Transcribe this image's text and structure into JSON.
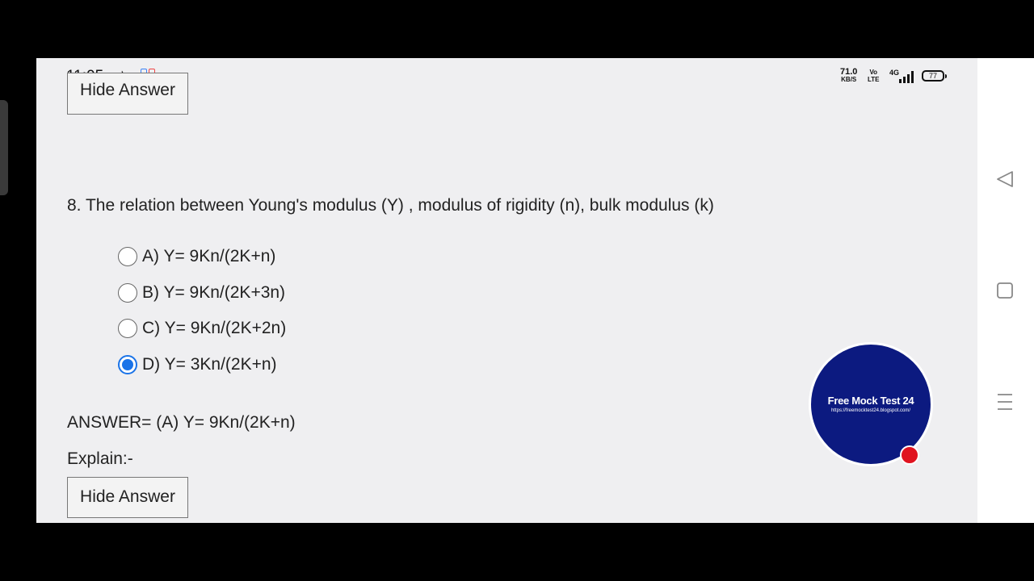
{
  "status_bar": {
    "time": "11:05",
    "net_speed_value": "71.0",
    "net_speed_unit": "KB/S",
    "volte_top": "Vo",
    "volte_bottom": "LTE",
    "signal_label": "4G",
    "battery": "77"
  },
  "page": {
    "top_button_label": "Hide Answer",
    "question": "8. The relation between Young's modulus (Y) , modulus of rigidity (n), bulk modulus (k)",
    "options": [
      {
        "label": "A) Y= 9Kn/(2K+n)",
        "selected": false
      },
      {
        "label": "B) Y= 9Kn/(2K+3n)",
        "selected": false
      },
      {
        "label": "C) Y= 9Kn/(2K+2n)",
        "selected": false
      },
      {
        "label": "D) Y= 3Kn/(2K+n)",
        "selected": true
      }
    ],
    "answer": "ANSWER= (A) Y= 9Kn/(2K+n)",
    "explain": "Explain:-",
    "bottom_button_label": "Hide Answer"
  },
  "overlay": {
    "logo_title": "Free Mock Test 24",
    "logo_url": "https://freemocktest24.blogspot.com/"
  },
  "colors": {
    "accent": "#1a73e8",
    "logo_bg": "#0c1a80",
    "record": "#e0131f"
  },
  "icons": {
    "nav_back": "back-triangle-icon",
    "nav_home": "home-square-icon",
    "nav_menu": "menu-lines-icon"
  }
}
